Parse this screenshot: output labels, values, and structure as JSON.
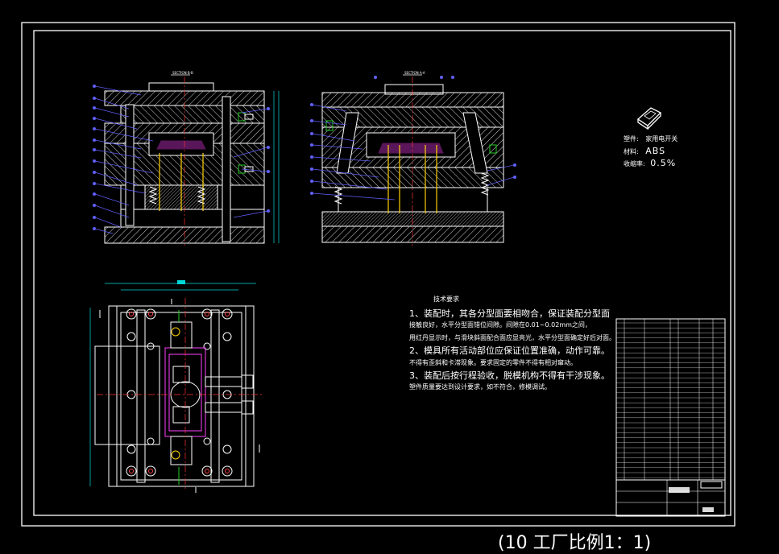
{
  "drawing": {
    "colors": {
      "background": "#000000",
      "outline": "#ffffff",
      "hatch": "#ffffff",
      "center_line": "#ff3333",
      "dimension": "#00d8d8",
      "leader": "#6060ff",
      "accent_part": "#ff40ff",
      "ejector": "#ffd000",
      "bolt_green": "#22cc22"
    },
    "part_spec": {
      "name_label": "塑件:",
      "name_value": "家用电开关",
      "material_label": "材料:",
      "material_value": "ABS",
      "shrink_label": "收缩率:",
      "shrink_value": "0.5%"
    },
    "requirements": {
      "title": "技术要求",
      "lines": [
        "1、装配时，其各分型面要相吻合，保证装配分型面",
        "接触良好，水平分型面错位间隙。间隙在0.01~0.02mm之间，",
        "用红丹显示时，与滑块斜面配合面应显亮光，水平分型面确定好后对面。",
        "2、模具所有活动部位应保证位置准确，动作可靠。",
        "不得有歪斜和卡滞现象。要求固定的零件不得有相对窜动。",
        "3、装配后按行程验收，脱模机构不得有干涉现象。",
        "塑件质量要达到设计要求，如不符合，修模调试。"
      ]
    },
    "bottom_caption": "(10 工厂比例1：1)"
  }
}
